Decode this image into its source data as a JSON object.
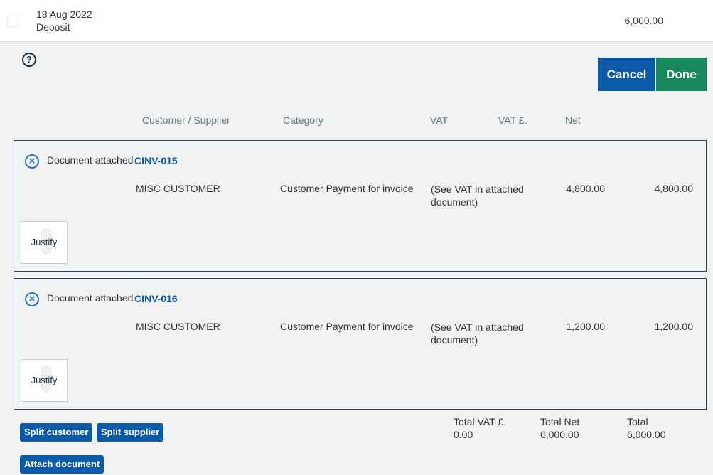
{
  "transaction": {
    "date": "18 Aug 2022",
    "type": "Deposit",
    "amount": "6,000.00"
  },
  "help": {
    "icon": "question-icon",
    "glyph": "?"
  },
  "actions": {
    "cancel_label": "Cancel",
    "done_label": "Done"
  },
  "columns": {
    "customer_supplier": "Customer / Supplier",
    "category": "Category",
    "vat": "VAT",
    "vat_amount": "VAT £.",
    "net": "Net"
  },
  "splits": [
    {
      "remove_glyph": "×",
      "attached_label": "Document attached",
      "document": "CINV-015",
      "customer": "MISC CUSTOMER",
      "category": "Customer Payment for invoice",
      "vat": "(See VAT in attached document)",
      "vat_amount": "4,800.00",
      "net": "4,800.00",
      "justify_label": "Justify"
    },
    {
      "remove_glyph": "×",
      "attached_label": "Document attached",
      "document": "CINV-016",
      "customer": "MISC CUSTOMER",
      "category": "Customer Payment for invoice",
      "vat": "(See VAT in attached document)",
      "vat_amount": "1,200.00",
      "net": "1,200.00",
      "justify_label": "Justify"
    }
  ],
  "footer_buttons": {
    "split_customer": "Split customer",
    "split_supplier": "Split supplier",
    "attach_document": "Attach document"
  },
  "totals": {
    "vat_label": "Total VAT £.",
    "vat_value": "0.00",
    "net_label": "Total Net",
    "net_value": "6,000.00",
    "total_label": "Total",
    "total_value": "6,000.00"
  },
  "colors": {
    "primary_blue": "#0b5aa7",
    "done_green": "#16885b",
    "panel_border": "#2c3f63",
    "background": "#f1f3f3"
  }
}
